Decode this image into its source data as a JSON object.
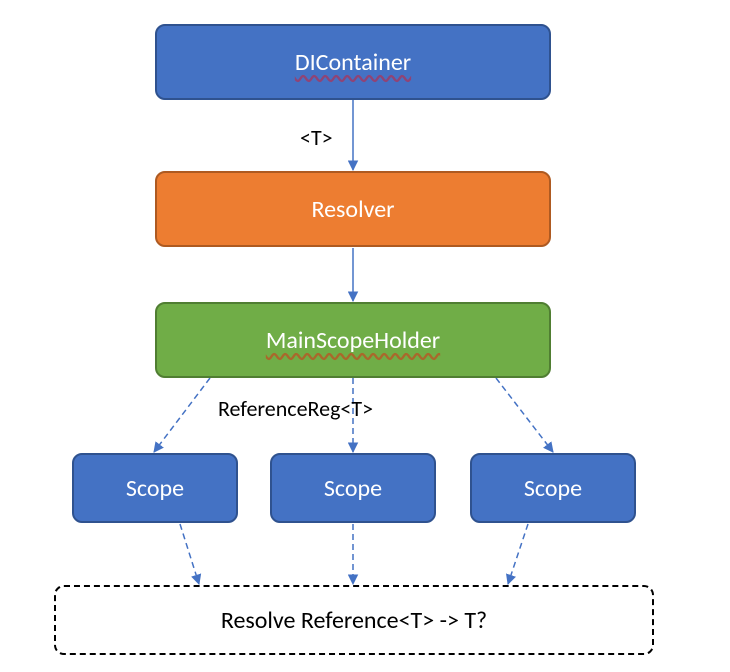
{
  "nodes": {
    "dicontainer": "DIContainer",
    "resolver": "Resolver",
    "mainscopeholder": "MainScopeHolder",
    "scope1": "Scope",
    "scope2": "Scope",
    "scope3": "Scope"
  },
  "edges": {
    "t_label": "<T>",
    "refreg_label": "ReferenceReg<T>"
  },
  "resolve_box": "Resolve Reference<T> -> T?",
  "colors": {
    "blue_fill": "#4472C4",
    "blue_border": "#2F528F",
    "orange_fill": "#ED7D31",
    "orange_border": "#AE5A21",
    "green_fill": "#70AD47",
    "green_border": "#507E32"
  }
}
